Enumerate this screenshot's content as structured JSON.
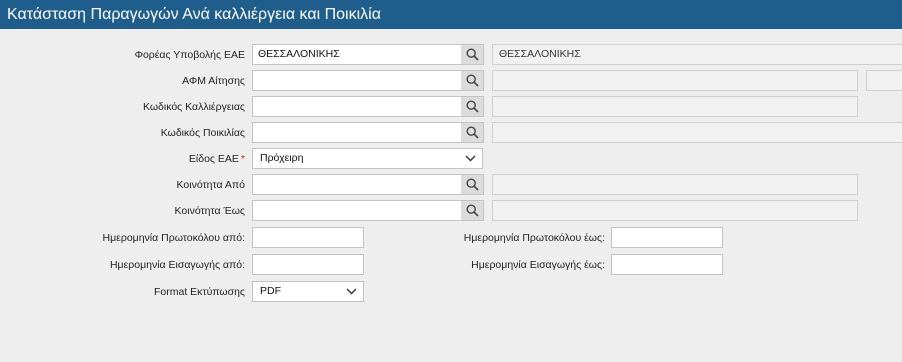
{
  "window": {
    "title": "Κατάσταση Παραγωγών Ανά καλλιέργεια και Ποικιλία"
  },
  "form": {
    "submitting_body": {
      "label": "Φορέας Υποβολής ΕΑΕ",
      "value": "ΘΕΣΣΑΛΟΝΙΚΗΣ",
      "description": "ΘΕΣΣΑΛΟΝΙΚΗΣ"
    },
    "applicant_afm": {
      "label": "ΑΦΜ Αίτησης",
      "value": "",
      "description": "",
      "extra": ""
    },
    "crop_code": {
      "label": "Κωδικός Καλλιέργειας",
      "value": "",
      "description": ""
    },
    "variety_code": {
      "label": "Κωδικός Ποικιλίας",
      "value": "",
      "description": ""
    },
    "eae_type": {
      "label": "Είδος ΕΑΕ",
      "required_mark": "*",
      "value": "Πρόχειρη"
    },
    "community_from": {
      "label": "Κοινότητα Από",
      "value": "",
      "description": ""
    },
    "community_to": {
      "label": "Κοινότητα Έως",
      "value": "",
      "description": ""
    },
    "protocol_date_from": {
      "label": "Ημερομηνία Πρωτοκόλου από:",
      "value": ""
    },
    "protocol_date_to": {
      "label": "Ημερομηνία Πρωτοκόλου έως:",
      "value": ""
    },
    "entry_date_from": {
      "label": "Ημερομηνία Εισαγωγής από:",
      "value": ""
    },
    "entry_date_to": {
      "label": "Ημερομηνία Εισαγωγής έως:",
      "value": ""
    },
    "print_format": {
      "label": "Format Εκτύπωσης",
      "value": "PDF"
    }
  },
  "icons": {
    "lookup": "search-icon",
    "dropdown": "chevron-down-icon"
  },
  "colors": {
    "title_bar": "#1e5d8c",
    "required": "#c0281f",
    "background": "#eeeeee"
  }
}
